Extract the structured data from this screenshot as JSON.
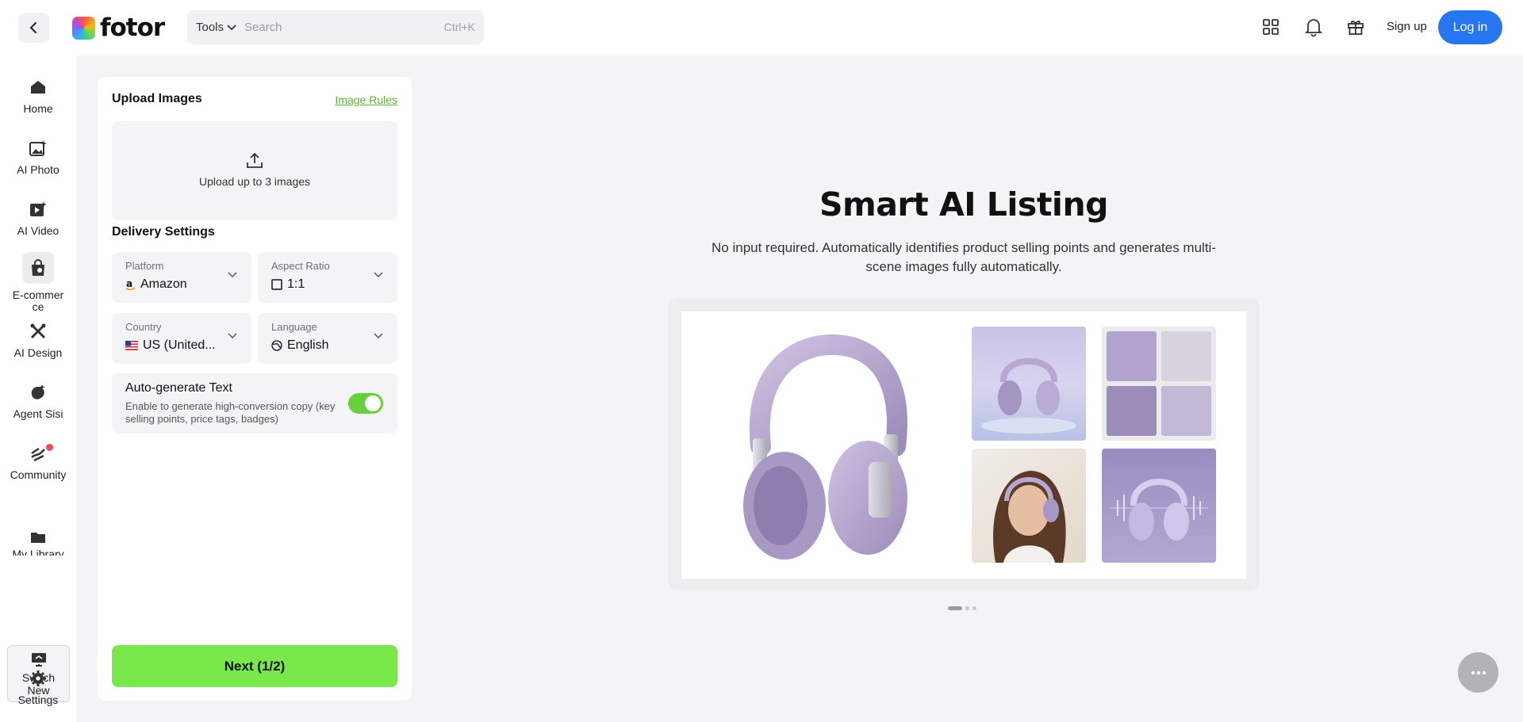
{
  "header": {
    "logo_text": "fotor",
    "tools_label": "Tools",
    "search_placeholder": "Search",
    "shortcut": "Ctrl+K",
    "signup_label": "Sign up",
    "login_label": "Log in"
  },
  "sidebar": {
    "items": [
      {
        "label": "Home",
        "icon": "home-icon"
      },
      {
        "label": "AI Photo",
        "icon": "ai-photo-icon"
      },
      {
        "label": "AI Video",
        "icon": "ai-video-icon"
      },
      {
        "label": "E-commerce",
        "icon": "shopping-bag-icon"
      },
      {
        "label": "AI Design",
        "icon": "ai-design-icon"
      },
      {
        "label": "Agent Sisi",
        "icon": "agent-icon"
      },
      {
        "label": "Community",
        "icon": "community-icon"
      },
      {
        "label": "My Library",
        "icon": "folder-icon"
      }
    ],
    "switch_label": "Switch New",
    "settings_label": "Settings"
  },
  "panel": {
    "upload_title": "Upload Images",
    "image_rules": "Image Rules",
    "upload_hint": "Upload up to 3 images",
    "delivery_title": "Delivery Settings",
    "platform": {
      "label": "Platform",
      "value": "Amazon"
    },
    "aspect_ratio": {
      "label": "Aspect Ratio",
      "value": "1:1"
    },
    "country": {
      "label": "Country",
      "value": "US (United..."
    },
    "language": {
      "label": "Language",
      "value": "English"
    },
    "autogen": {
      "title": "Auto-generate Text",
      "desc": "Enable to generate high-conversion copy (key selling points, price tags, badges)",
      "enabled": true
    },
    "next_label": "Next (1/2)"
  },
  "main": {
    "title": "Smart AI Listing",
    "subtitle": "No input required. Automatically identifies product selling points and generates multi-scene images fully automatically.",
    "carousel": {
      "pages": 3,
      "current": 1
    }
  },
  "colors": {
    "accent_green": "#79e84a",
    "toggle_green": "#66d13a",
    "link_green": "#5ab531",
    "login_blue": "#2576ef",
    "product_lavender": "#b9a9d1"
  }
}
